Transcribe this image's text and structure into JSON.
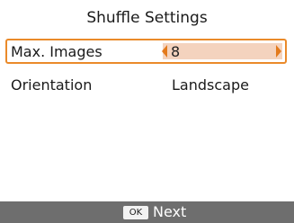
{
  "title": "Shuffle Settings",
  "settings": [
    {
      "label": "Max. Images",
      "value": "8",
      "selected": true
    },
    {
      "label": "Orientation",
      "value": "Landscape",
      "selected": false
    }
  ],
  "footer": {
    "ok_label": "OK",
    "action_label": "Next"
  },
  "colors": {
    "accent": "#ea8a2a",
    "value_fill": "#f4d3be",
    "footer_bg": "#6e6e6e"
  }
}
